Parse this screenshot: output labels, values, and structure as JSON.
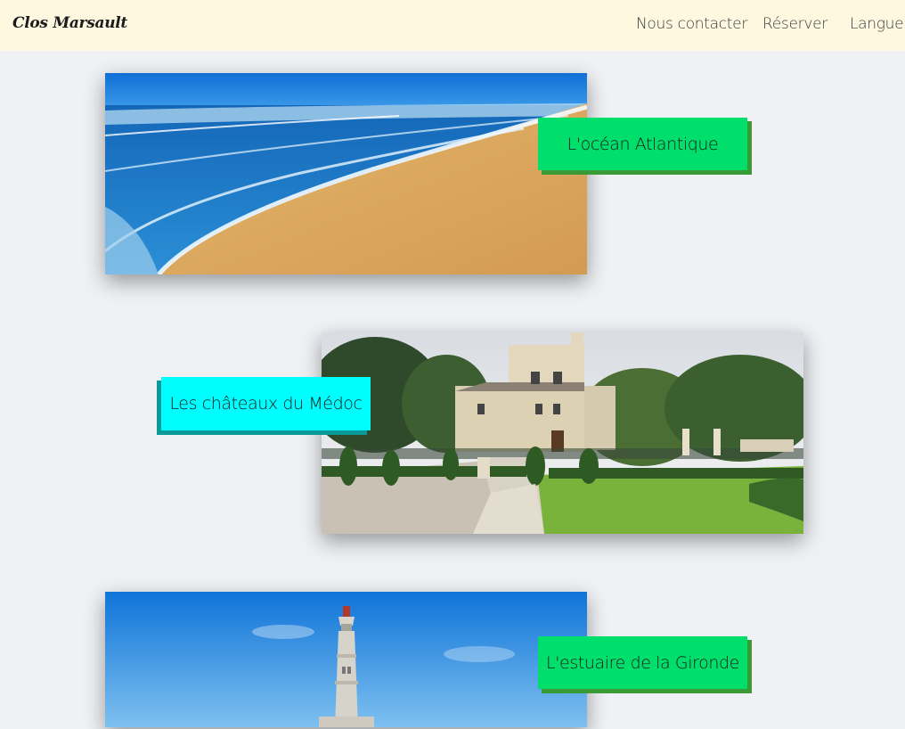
{
  "nav": {
    "brand": "Clos Marsault",
    "links": [
      "Nous contacter",
      "Réserver",
      "Langue"
    ]
  },
  "cards": [
    {
      "caption": "L'océan Atlantique",
      "caption_color": "#00df6b",
      "shadow_color": "#3a9a35"
    },
    {
      "caption": "Les châteaux du Médoc",
      "caption_color": "#00fefe",
      "shadow_color": "#0a9b98"
    },
    {
      "caption": "L'estuaire de la Gironde",
      "caption_color": "#00df6b",
      "shadow_color": "#3a9a35"
    }
  ]
}
